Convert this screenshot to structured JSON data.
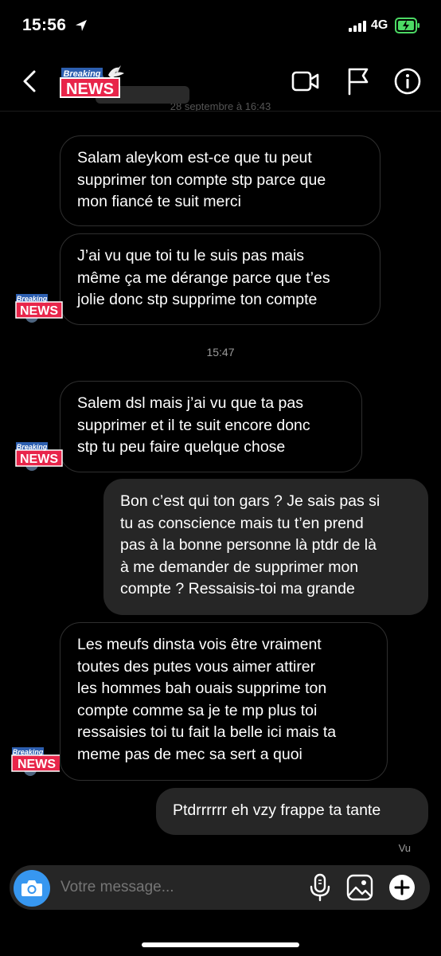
{
  "status_bar": {
    "time": "15:56",
    "network": "4G"
  },
  "header": {
    "avatar_line1": "Breaking",
    "avatar_line2": "NEWS",
    "partial_date": "28 septembre à 16:43"
  },
  "messages": [
    {
      "type": "received",
      "text": "Salam aleykom est-ce que tu peut\nsupprimer ton compte stp parce que\nmon fiancé te suit merci"
    },
    {
      "type": "received",
      "text": "J’ai vu que toi tu le suis pas mais\nmême ça me dérange parce que t’es\njolie donc stp supprime ton compte"
    },
    {
      "type": "timestamp",
      "text": "15:47"
    },
    {
      "type": "received",
      "text": "Salem dsl mais j’ai vu que ta pas\nsupprimer et il te suit encore donc\nstp tu peu faire quelque chose"
    },
    {
      "type": "sent",
      "text": "Bon c’est qui ton gars ? Je sais pas si\ntu as conscience mais tu t’en prend\npas à la bonne personne là ptdr de là\nà me demander de supprimer mon\ncompte ? Ressaisis-toi ma grande"
    },
    {
      "type": "received",
      "text": "Les meufs dinsta vois être vraiment\ntoutes des putes vous aimer attirer\nles hommes bah ouais supprime ton\ncompte comme sa je te mp plus toi\nressaisies toi tu fait la belle ici mais ta\nmeme pas de mec sa sert a quoi"
    },
    {
      "type": "sent",
      "text": "Ptdrrrrrr eh vzy frappe ta tante"
    }
  ],
  "seen_label": "Vu",
  "composer": {
    "placeholder": "Votre message..."
  },
  "colors": {
    "background": "#000000",
    "sent_bubble": "#262626",
    "camera_button": "#3797f0",
    "news_red": "#e8254a",
    "news_blue": "#2d5fb0",
    "battery_green": "#4cd964"
  },
  "icons": [
    "location-arrow-icon",
    "signal-icon",
    "battery-charging-icon",
    "back-arrow-icon",
    "video-call-icon",
    "flag-icon",
    "info-icon",
    "camera-icon",
    "microphone-icon",
    "gallery-icon",
    "plus-icon",
    "dove-icon"
  ]
}
